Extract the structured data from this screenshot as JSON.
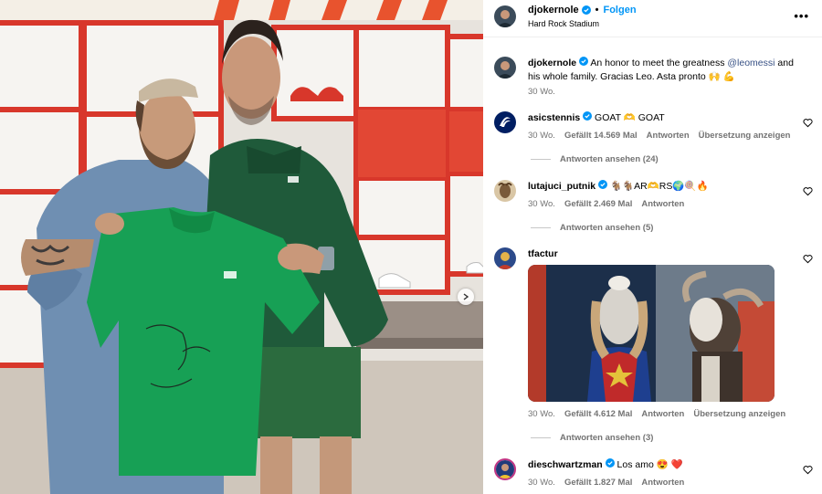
{
  "post": {
    "username": "djokernole",
    "follow_label": "Folgen",
    "location": "Hard Rock Stadium",
    "more_label": "•••",
    "caption_text": " An honor to meet the greatness ",
    "caption_mention": "@leomessi",
    "caption_tail": " and his whole family. Gracias Leo. Asta pronto 🙌 💪",
    "caption_age": "30 Wo."
  },
  "comments": [
    {
      "username": "asicstennis",
      "text": "GOAT 🫶 GOAT",
      "age": "30 Wo.",
      "likes": "Gefällt 14.569 Mal",
      "reply": "Antworten",
      "translate": "Übersetzung anzeigen",
      "view_replies": "Antworten ansehen (24)"
    },
    {
      "username": "lutajuci_putnik",
      "text": "🐐🐐AR🫶RS🌍🍭🔥",
      "age": "30 Wo.",
      "likes": "Gefällt 2.469 Mal",
      "reply": "Antworten",
      "view_replies": "Antworten ansehen (5)"
    },
    {
      "username": "tfactur",
      "age": "30 Wo.",
      "likes": "Gefällt 4.612 Mal",
      "reply": "Antworten",
      "translate": "Übersetzung anzeigen",
      "view_replies": "Antworten ansehen (3)"
    },
    {
      "username": "dieschwartzman",
      "text": "Los amo 😍 ❤️",
      "age": "30 Wo.",
      "likes": "Gefällt 1.827 Mal",
      "reply": "Antworten"
    }
  ],
  "colors": {
    "accent": "#0095f6",
    "verified": "#0095f6",
    "secondary_text": "#737373"
  }
}
